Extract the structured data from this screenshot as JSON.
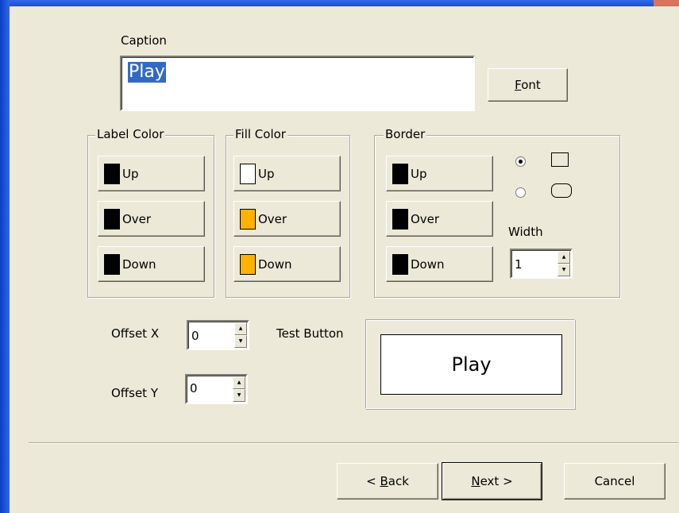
{
  "caption": {
    "label": "Caption",
    "value": "Play",
    "font_button": "Font"
  },
  "label_color": {
    "title": "Label Color",
    "buttons": [
      {
        "label": "Up",
        "color": "#000000"
      },
      {
        "label": "Over",
        "color": "#000000"
      },
      {
        "label": "Down",
        "color": "#000000"
      }
    ]
  },
  "fill_color": {
    "title": "Fill Color",
    "buttons": [
      {
        "label": "Up",
        "color": "#ffffff"
      },
      {
        "label": "Over",
        "color": "#ffb300"
      },
      {
        "label": "Down",
        "color": "#ffb300"
      }
    ]
  },
  "border": {
    "title": "Border",
    "buttons": [
      {
        "label": "Up",
        "color": "#000000"
      },
      {
        "label": "Over",
        "color": "#000000"
      },
      {
        "label": "Down",
        "color": "#000000"
      }
    ],
    "shape_selected": "rectangle",
    "width_label": "Width",
    "width_value": "1"
  },
  "offset": {
    "x_label": "Offset X",
    "x_value": "0",
    "y_label": "Offset Y",
    "y_value": "0"
  },
  "test": {
    "label": "Test Button",
    "button_text": "Play"
  },
  "footer": {
    "back": "< Back",
    "next": "Next >",
    "cancel": "Cancel"
  }
}
